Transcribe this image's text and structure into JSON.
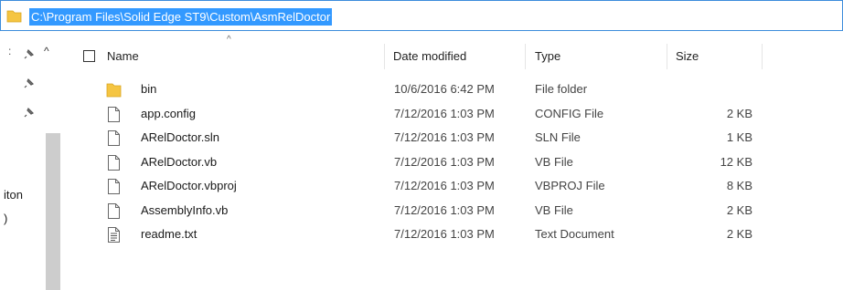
{
  "address_bar": {
    "path": "C:\\Program Files\\Solid Edge ST9\\Custom\\AsmRelDoctor"
  },
  "nav": {
    "partial_label_1": "iton",
    "partial_label_2": ")"
  },
  "columns": {
    "name": "Name",
    "date": "Date modified",
    "type": "Type",
    "size": "Size"
  },
  "files": [
    {
      "name": "bin",
      "date": "10/6/2016 6:42 PM",
      "type": "File folder",
      "size": "",
      "icon": "folder-icon"
    },
    {
      "name": "app.config",
      "date": "7/12/2016 1:03 PM",
      "type": "CONFIG File",
      "size": "2 KB",
      "icon": "file-icon"
    },
    {
      "name": "ARelDoctor.sln",
      "date": "7/12/2016 1:03 PM",
      "type": "SLN File",
      "size": "1 KB",
      "icon": "file-icon"
    },
    {
      "name": "ARelDoctor.vb",
      "date": "7/12/2016 1:03 PM",
      "type": "VB File",
      "size": "12 KB",
      "icon": "file-icon"
    },
    {
      "name": "ARelDoctor.vbproj",
      "date": "7/12/2016 1:03 PM",
      "type": "VBPROJ File",
      "size": "8 KB",
      "icon": "file-icon"
    },
    {
      "name": "AssemblyInfo.vb",
      "date": "7/12/2016 1:03 PM",
      "type": "VB File",
      "size": "2 KB",
      "icon": "file-icon"
    },
    {
      "name": "readme.txt",
      "date": "7/12/2016 1:03 PM",
      "type": "Text Document",
      "size": "2 KB",
      "icon": "text-file-icon"
    }
  ],
  "colors": {
    "selection": "#3399ff",
    "folder": "#f5c542",
    "scrollbar": "#cdcdcd"
  }
}
